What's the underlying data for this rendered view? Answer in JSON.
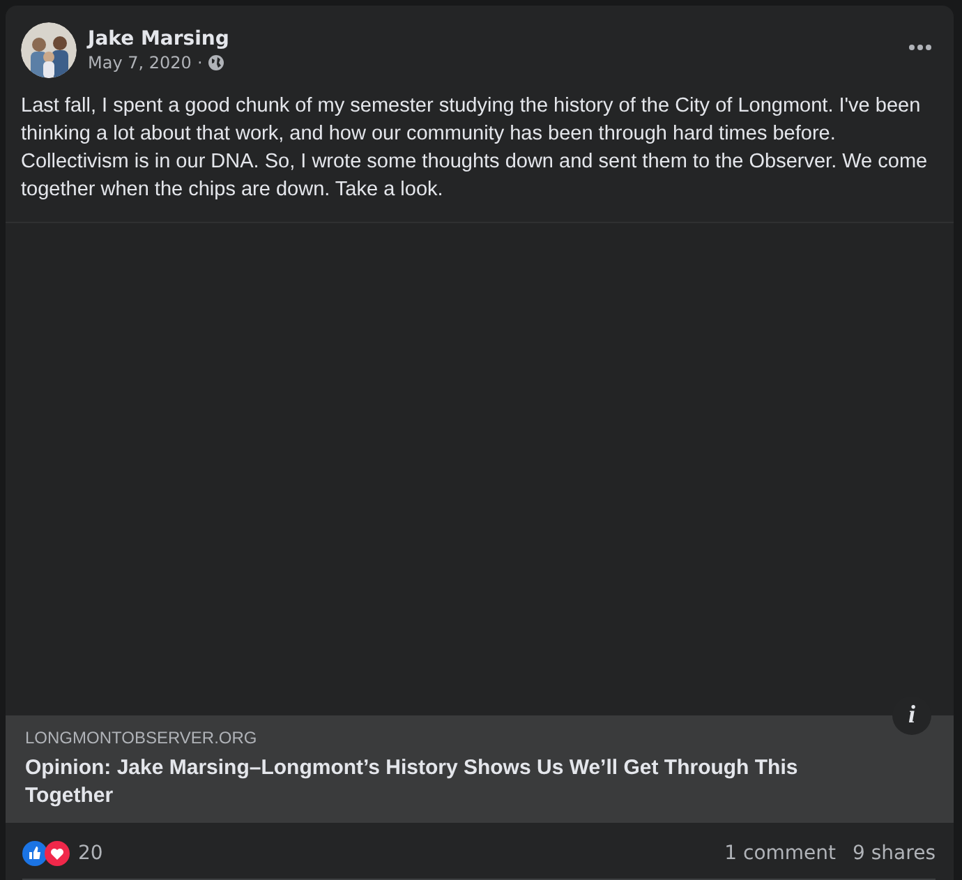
{
  "post": {
    "author": "Jake Marsing",
    "date": "May 7, 2020",
    "separator": "·",
    "text": "Last fall, I spent a good chunk of my semester studying the history of the City of Longmont. I've been thinking a lot about that work, and how our community has been through hard times before. Collectivism is in our DNA. So, I wrote some thoughts down and sent them to the Observer. We come together when the chips are down. Take a look."
  },
  "link": {
    "domain": "LONGMONTOBSERVER.ORG",
    "title": "Opinion: Jake Marsing–Longmont’s History Shows Us We’ll Get Through This Together",
    "info": "i"
  },
  "footer": {
    "reaction_count": "20",
    "comments": "1 comment",
    "shares": "9 shares"
  }
}
